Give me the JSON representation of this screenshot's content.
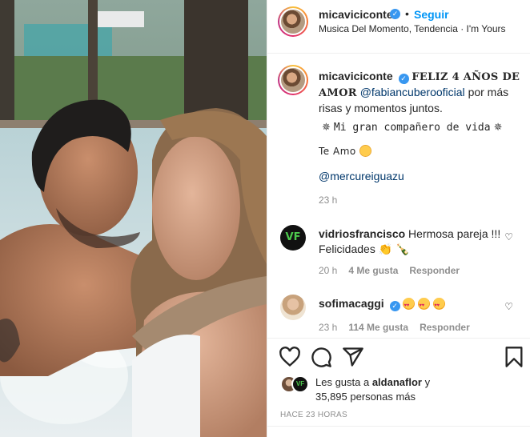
{
  "post": {
    "username": "micaviciconte",
    "verified_mark": "✓",
    "separator": "•",
    "follow_label": "Seguir",
    "subtitle": "Musica Del Momento, Tendencia · I'm Yours",
    "more_label": "···"
  },
  "caption": {
    "username": "micaviciconte",
    "headline": "FELIZ 4 AÑOS DE AMOR",
    "mention": "@fabiancuberooficial",
    "text_after_mention": "por más risas y momentos juntos.",
    "companion_line": "Mi gran compañero de vida",
    "sparkle": "✵",
    "love_line": "Te Amo",
    "location_mention": "@mercureiguazu",
    "time": "23 h"
  },
  "comments": [
    {
      "username": "vidriosfrancisco",
      "avatar_text": "VF",
      "text": "Hermosa pareja !!! Felicidades 👏 🍾",
      "time": "20 h",
      "likes": "4 Me gusta",
      "reply": "Responder"
    },
    {
      "username": "sofimacaggi",
      "text": "😍😍😍",
      "time": "23 h",
      "likes": "114 Me gusta",
      "reply": "Responder"
    }
  ],
  "likes": {
    "avatar2_text": "VF",
    "prefix": "Les gusta a ",
    "user": "aldanaflor",
    "suffix": " y",
    "count_line": "35,895 personas más"
  },
  "timestamp": "HACE 23 HORAS",
  "icons": [
    "heart-icon",
    "comment-icon",
    "share-icon",
    "bookmark-icon",
    "small-heart-icon",
    "more-icon"
  ]
}
